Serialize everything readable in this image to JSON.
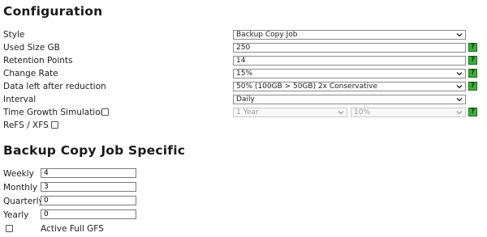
{
  "config": {
    "heading": "Configuration",
    "rows": {
      "style": {
        "label": "Style",
        "value": "Backup Copy Job"
      },
      "used_size": {
        "label": "Used Size GB",
        "value": "250"
      },
      "retention": {
        "label": "Retention Points",
        "value": "14"
      },
      "change_rate": {
        "label": "Change Rate",
        "value": "15%"
      },
      "reduction": {
        "label": "Data left after reduction",
        "value": "50% (100GB > 50GB) 2x Conservative"
      },
      "interval": {
        "label": "Interval",
        "value": "Daily"
      },
      "growth": {
        "label": "Time Growth Simulation",
        "checked": false,
        "period": "1 Year",
        "rate": "10%"
      },
      "refs": {
        "label": "ReFS / XFS",
        "checked": false
      }
    },
    "help_glyph": "?",
    "help_color": "#3cae3c"
  },
  "bcj": {
    "heading": "Backup Copy Job Specific",
    "rows": {
      "weekly": {
        "label": "Weekly",
        "value": "4"
      },
      "monthly": {
        "label": "Monthly",
        "value": "3"
      },
      "quarterly": {
        "label": "Quarterly",
        "value": "0"
      },
      "yearly": {
        "label": "Yearly",
        "value": "0"
      },
      "active_full": {
        "label": "Active Full GFS",
        "checked": false
      }
    }
  },
  "icons": {
    "help": "help-icon",
    "dropdown": "chevron-down-icon"
  }
}
